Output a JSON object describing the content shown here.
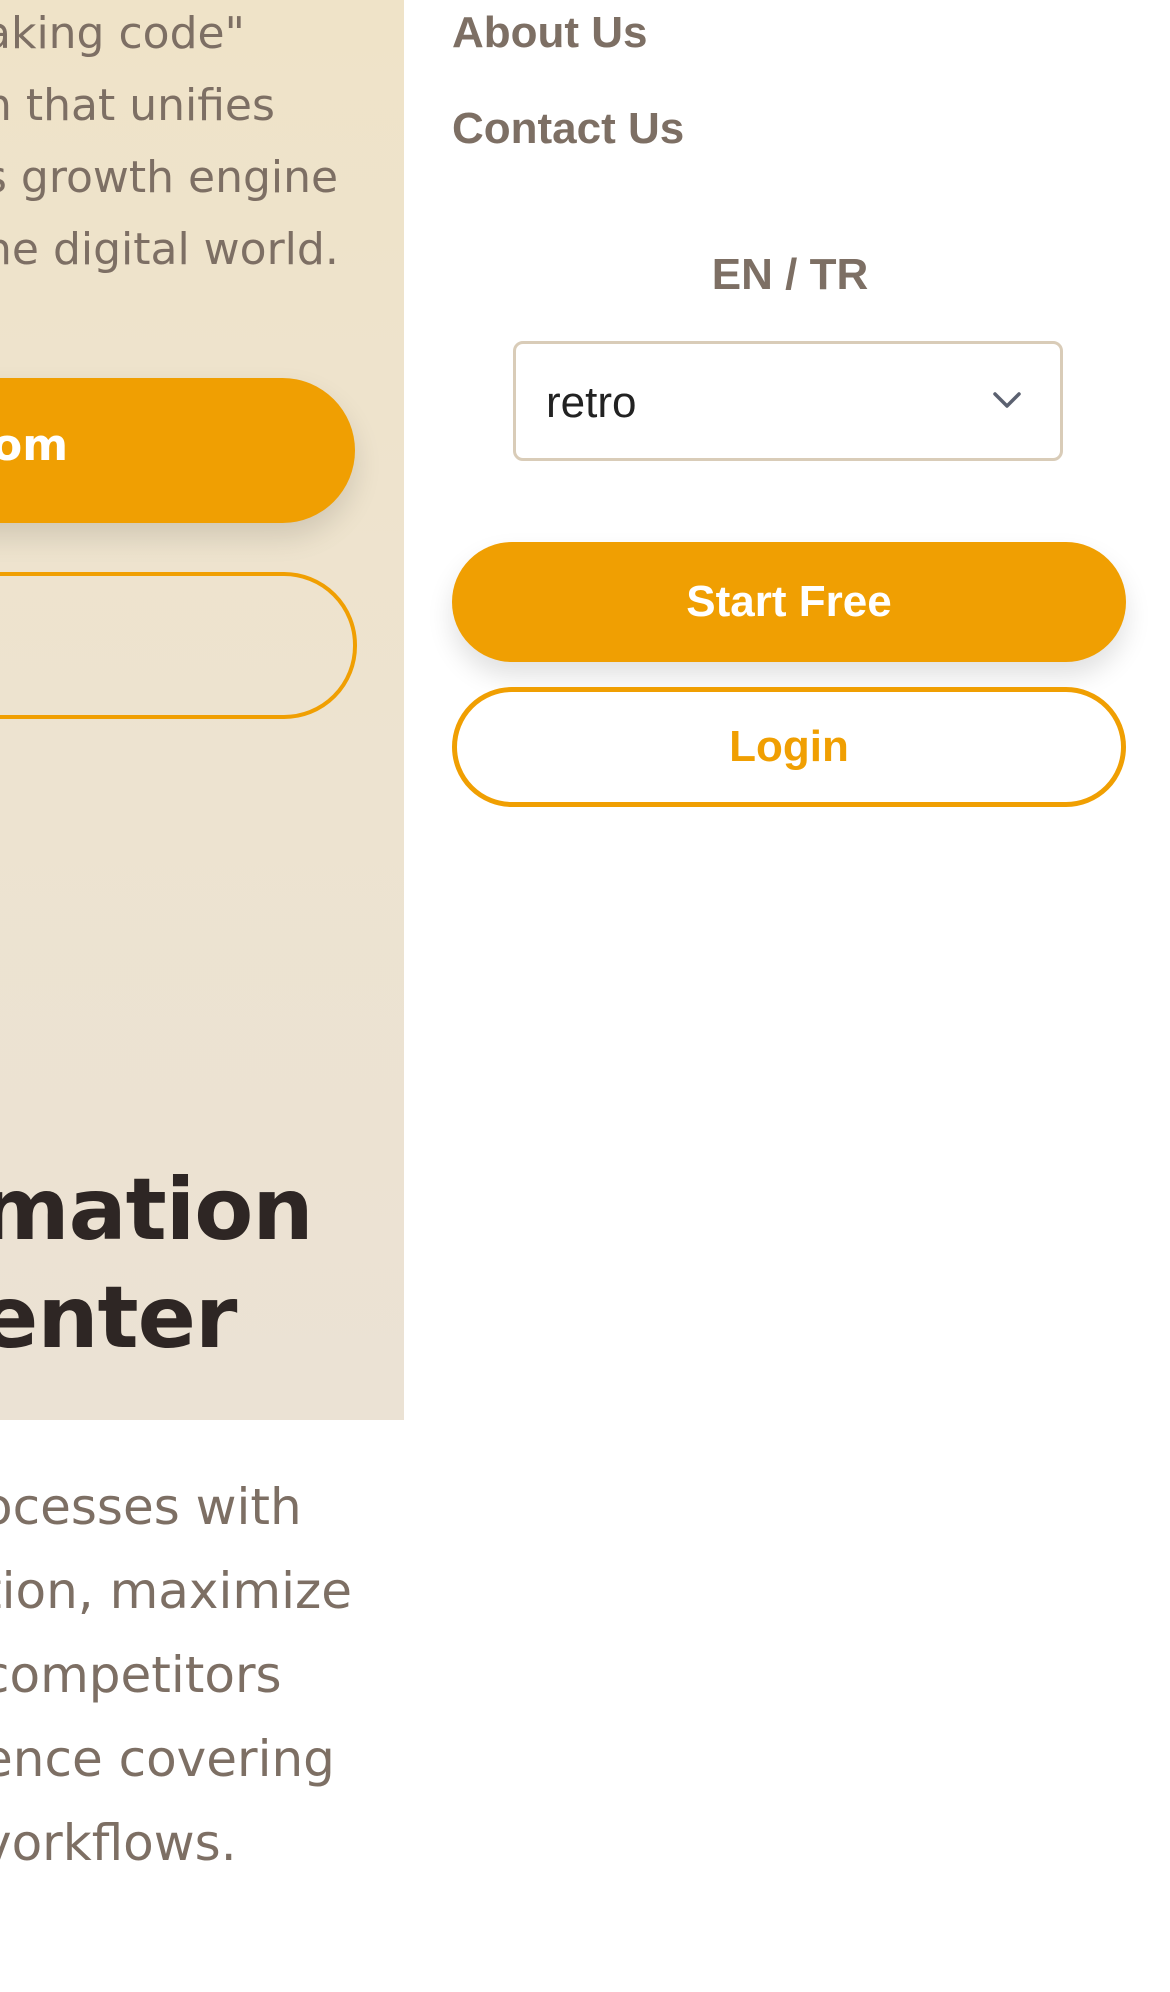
{
  "background_page": {
    "hero_paragraph_lines": [
      "aking code\"",
      "n that unifies",
      "s growth engine",
      "he digital world."
    ],
    "hero_primary_button_label": "om",
    "section_heading_lines": [
      "mation",
      "enter"
    ],
    "section_body_lines": [
      "ocesses with",
      "tion, maximize",
      "competitors",
      "ence covering",
      "vorkflows."
    ]
  },
  "menu": {
    "items": [
      {
        "label": "About Us"
      },
      {
        "label": "Contact Us"
      }
    ],
    "language_label": "EN / TR",
    "theme_select": {
      "value": "retro",
      "icon": "chevron-down-icon"
    },
    "start_free_label": "Start Free",
    "login_label": "Login"
  },
  "colors": {
    "accent": "#f09f02",
    "panel_bg": "#ede3d0",
    "muted_text": "#7d6f64",
    "heading_text": "#2e2624"
  }
}
